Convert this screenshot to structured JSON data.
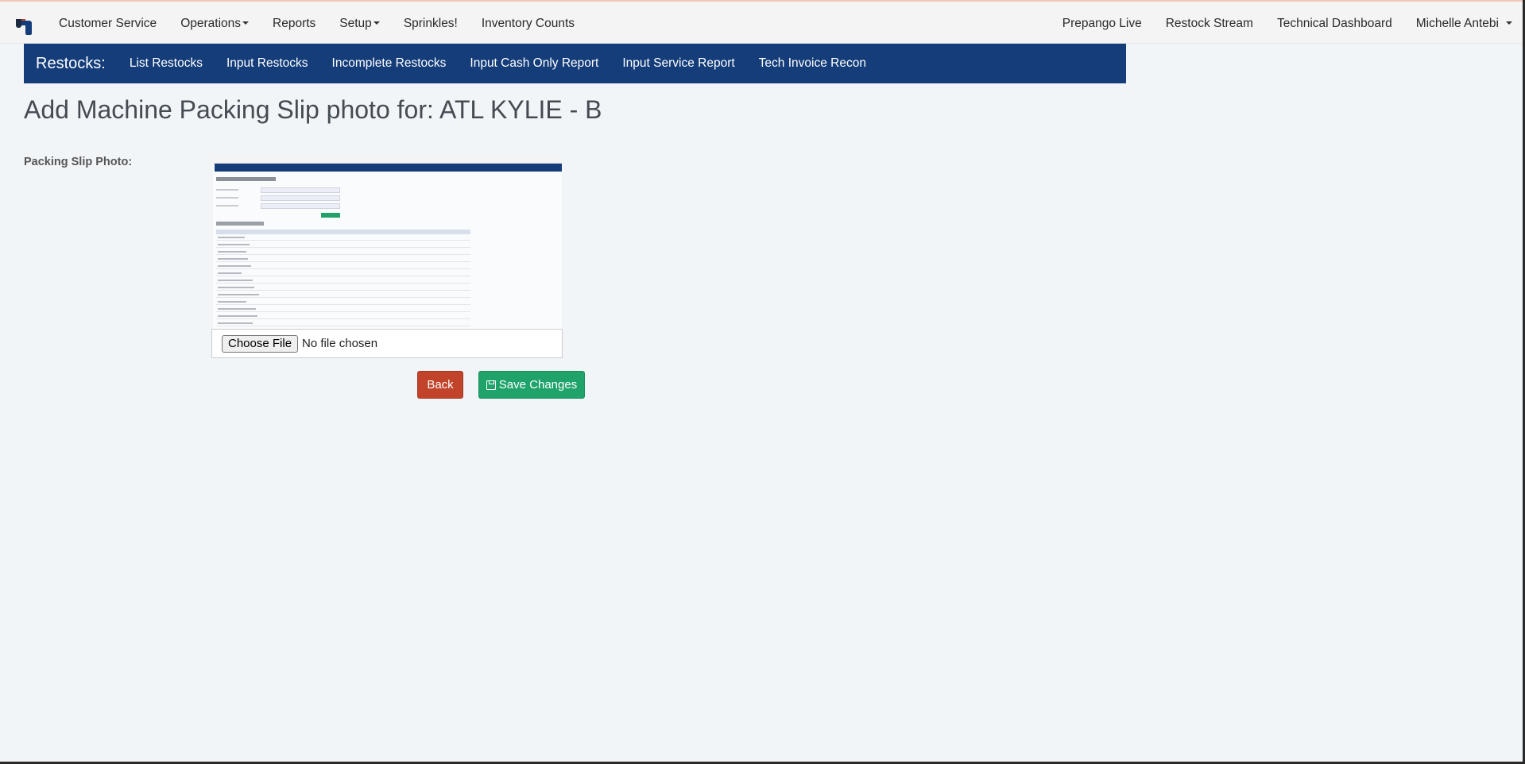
{
  "navbar": {
    "left_items": [
      {
        "label": "Customer Service",
        "dropdown": false
      },
      {
        "label": "Operations",
        "dropdown": true
      },
      {
        "label": "Reports",
        "dropdown": false
      },
      {
        "label": "Setup",
        "dropdown": true
      },
      {
        "label": "Sprinkles!",
        "dropdown": false
      },
      {
        "label": "Inventory Counts",
        "dropdown": false
      }
    ],
    "right_items": [
      {
        "label": "Prepango Live"
      },
      {
        "label": "Restock Stream"
      },
      {
        "label": "Technical Dashboard"
      }
    ],
    "user_menu": "Michelle Antebi"
  },
  "subnav": {
    "title": "Restocks:",
    "items": [
      "List Restocks",
      "Input Restocks",
      "Incomplete Restocks",
      "Input Cash Only Report",
      "Input Service Report",
      "Tech Invoice Recon"
    ]
  },
  "page": {
    "title": "Add Machine Packing Slip photo for: ATL KYLIE - B",
    "field_label": "Packing Slip Photo:",
    "file_input": {
      "button_label": "Choose File",
      "status": "No file chosen"
    },
    "back_label": "Back",
    "save_label": "Save Changes"
  },
  "colors": {
    "subnav_bg": "#143d7a",
    "back_button": "#c0432a",
    "save_button": "#1fa36b",
    "page_bg": "#f2f5f8"
  },
  "icons": {
    "logo": "prepango-logo",
    "save": "floppy-disk-icon"
  }
}
